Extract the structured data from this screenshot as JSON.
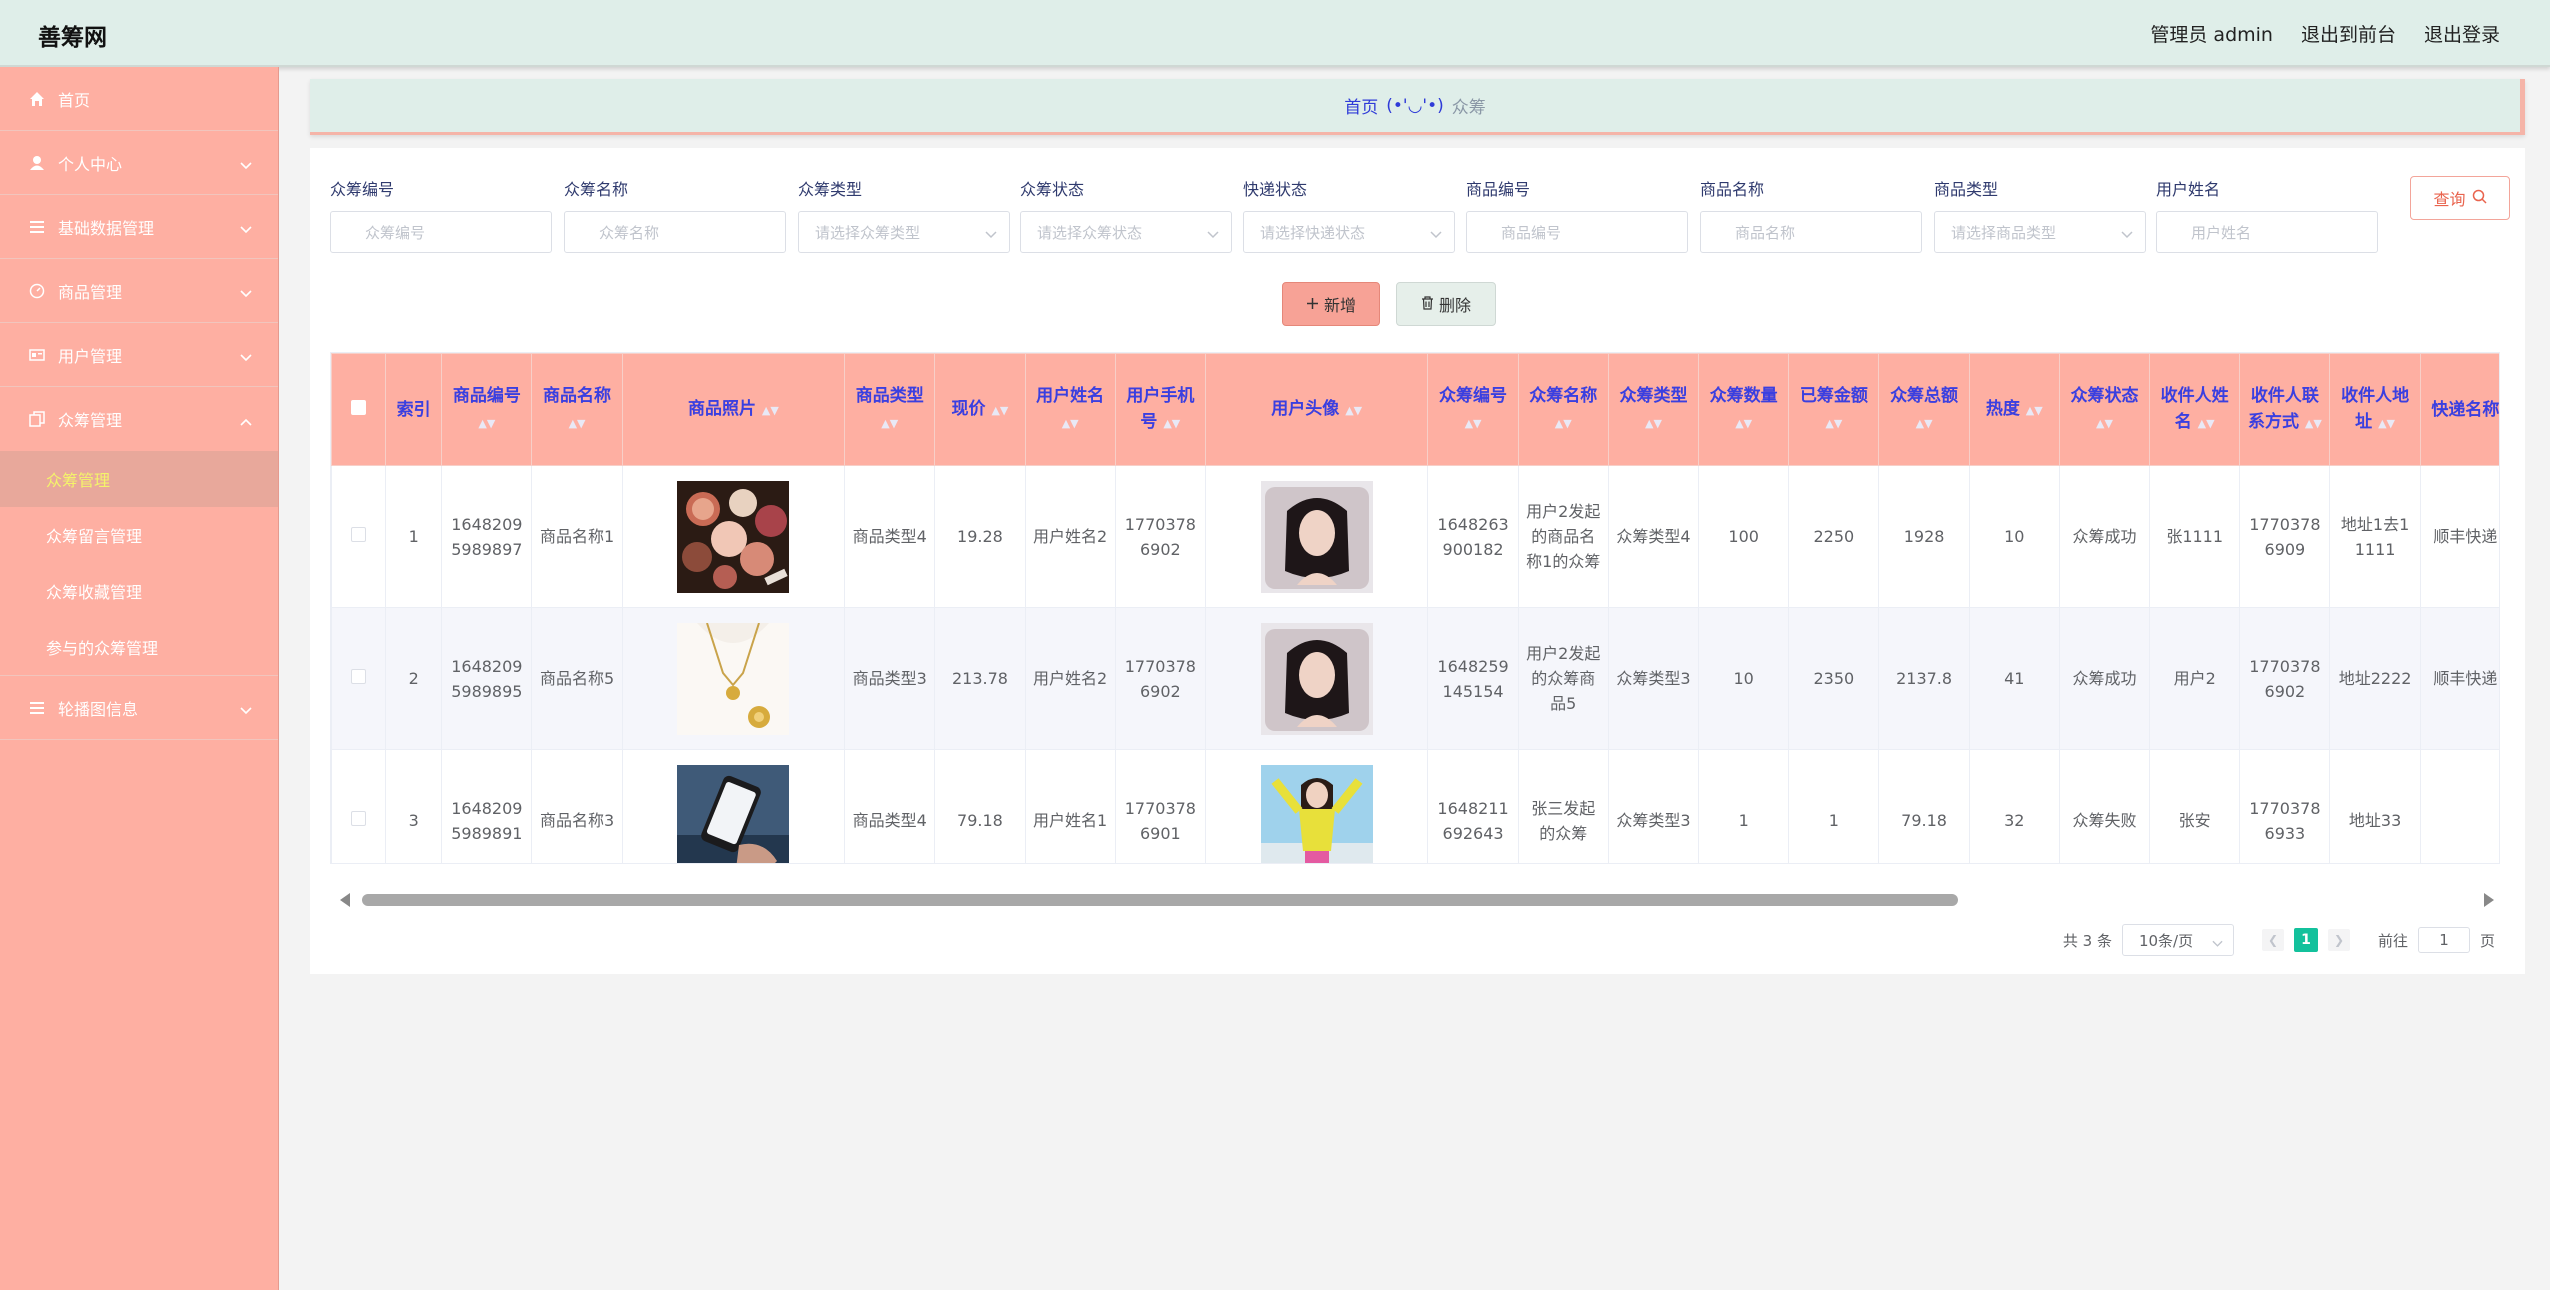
{
  "header": {
    "brand": "善筹网",
    "admin": "管理员 admin",
    "to_front": "退出到前台",
    "logout": "退出登录"
  },
  "sidebar": {
    "items": [
      {
        "label": "首页",
        "icon": "home-icon"
      },
      {
        "label": "个人中心",
        "icon": "user-icon"
      },
      {
        "label": "基础数据管理",
        "icon": "list-icon"
      },
      {
        "label": "商品管理",
        "icon": "gauge-icon"
      },
      {
        "label": "用户管理",
        "icon": "id-card-icon"
      },
      {
        "label": "众筹管理",
        "icon": "copy-icon"
      }
    ],
    "subitems": [
      "众筹管理",
      "众筹留言管理",
      "众筹收藏管理",
      "参与的众筹管理"
    ],
    "last": {
      "label": "轮播图信息",
      "icon": "list-icon"
    }
  },
  "breadcrumb": {
    "home": "首页",
    "face": "(•'◡'•)",
    "current": "众筹"
  },
  "filters": [
    {
      "label": "众筹编号",
      "placeholder": "众筹编号"
    },
    {
      "label": "众筹名称",
      "placeholder": "众筹名称"
    },
    {
      "label": "众筹类型",
      "placeholder": "请选择众筹类型"
    },
    {
      "label": "众筹状态",
      "placeholder": "请选择众筹状态"
    },
    {
      "label": "快递状态",
      "placeholder": "请选择快递状态"
    },
    {
      "label": "商品编号",
      "placeholder": "商品编号"
    },
    {
      "label": "商品名称",
      "placeholder": "商品名称"
    },
    {
      "label": "商品类型",
      "placeholder": "请选择商品类型"
    },
    {
      "label": "用户姓名",
      "placeholder": "用户姓名"
    }
  ],
  "buttons": {
    "query": "查询",
    "add": "新增",
    "delete": "删除"
  },
  "table": {
    "headers": [
      "索引",
      "商品编号",
      "商品名称",
      "商品照片",
      "商品类型",
      "现价",
      "用户姓名",
      "用户手机号",
      "用户头像",
      "众筹编号",
      "众筹名称",
      "众筹类型",
      "众筹数量",
      "已筹金额",
      "众筹总额",
      "热度",
      "众筹状态",
      "收件人姓名",
      "收件人联系方式",
      "收件人地址",
      "快递名称"
    ],
    "rows": [
      {
        "index": "1",
        "goods_no": "16482095989897",
        "goods_name": "商品名称1",
        "goods_type": "商品类型4",
        "price": "19.28",
        "user_name": "用户姓名2",
        "phone": "17703786902",
        "crowd_no": "1648263900182",
        "crowd_name": "用户2发起的商品名称1的众筹",
        "crowd_type": "众筹类型4",
        "qty": "100",
        "raised": "2250",
        "total": "1928",
        "heat": "10",
        "status": "众筹成功",
        "recv_name": "张1111",
        "recv_phone": "17703786909",
        "recv_addr": "地址1去11111",
        "express": "顺丰快递"
      },
      {
        "index": "2",
        "goods_no": "16482095989895",
        "goods_name": "商品名称5",
        "goods_type": "商品类型3",
        "price": "213.78",
        "user_name": "用户姓名2",
        "phone": "17703786902",
        "crowd_no": "1648259145154",
        "crowd_name": "用户2发起的众筹商品5",
        "crowd_type": "众筹类型3",
        "qty": "10",
        "raised": "2350",
        "total": "2137.8",
        "heat": "41",
        "status": "众筹成功",
        "recv_name": "用户2",
        "recv_phone": "17703786902",
        "recv_addr": "地址2222",
        "express": "顺丰快递"
      },
      {
        "index": "3",
        "goods_no": "16482095989891",
        "goods_name": "商品名称3",
        "goods_type": "商品类型4",
        "price": "79.18",
        "user_name": "用户姓名1",
        "phone": "17703786901",
        "crowd_no": "1648211692643",
        "crowd_name": "张三发起的众筹",
        "crowd_type": "众筹类型3",
        "qty": "1",
        "raised": "1",
        "total": "79.18",
        "heat": "32",
        "status": "众筹失败",
        "recv_name": "张安",
        "recv_phone": "17703786933",
        "recv_addr": "地址33",
        "express": ""
      }
    ]
  },
  "pager": {
    "total": "共 3 条",
    "size": "10条/页",
    "current": "1",
    "goto": "前往",
    "goto_value": "1",
    "page_unit": "页"
  }
}
